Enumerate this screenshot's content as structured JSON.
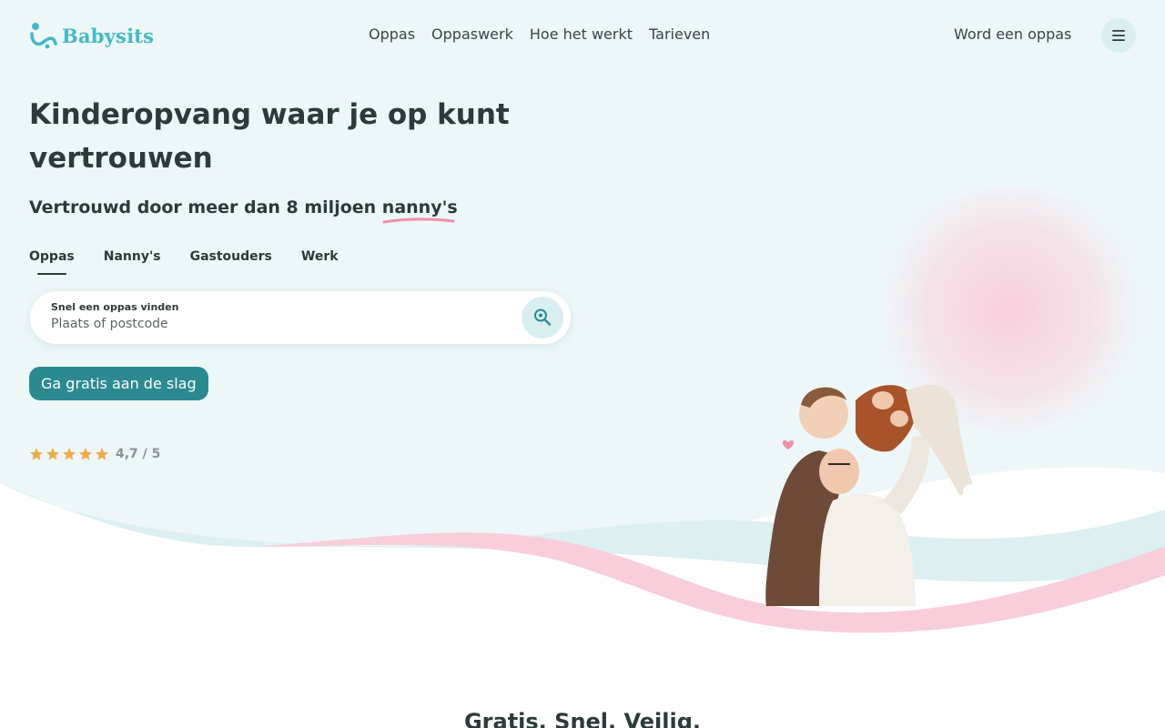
{
  "header": {
    "logo_text": "Babysits",
    "nav": [
      "Oppas",
      "Oppaswerk",
      "Hoe het werkt",
      "Tarieven"
    ],
    "become_sitter": "Word een oppas"
  },
  "hero": {
    "title": "Kinderopvang waar je op kunt vertrouwen",
    "subtitle_prefix": "Vertrouwd door meer dan 8 miljoen",
    "subtitle_highlight": "nanny's"
  },
  "tabs": [
    {
      "label": "Oppas",
      "active": true
    },
    {
      "label": "Nanny's",
      "active": false
    },
    {
      "label": "Gastouders",
      "active": false
    },
    {
      "label": "Werk",
      "active": false
    }
  ],
  "search": {
    "label": "Snel een oppas vinden",
    "placeholder": "Plaats of postcode",
    "value": ""
  },
  "cta_label": "Ga gratis aan de slag",
  "rating": {
    "stars": 5,
    "text": "4,7 / 5"
  },
  "section_heading": "Gratis. Snel. Veilig.",
  "colors": {
    "brand": "#43b9c8",
    "primary_button": "#2a8a90",
    "hero_background": "#eef7f7",
    "wave_light": "#dcf0f2",
    "wave_pink": "#f9cedb",
    "star": "#f0a948",
    "highlight_underline": "#ef8fae"
  },
  "icons": {
    "logo": "babysits-logo-icon",
    "menu": "hamburger-menu-icon",
    "search": "search-location-icon",
    "star": "star-icon",
    "heart": "heart-icon"
  }
}
